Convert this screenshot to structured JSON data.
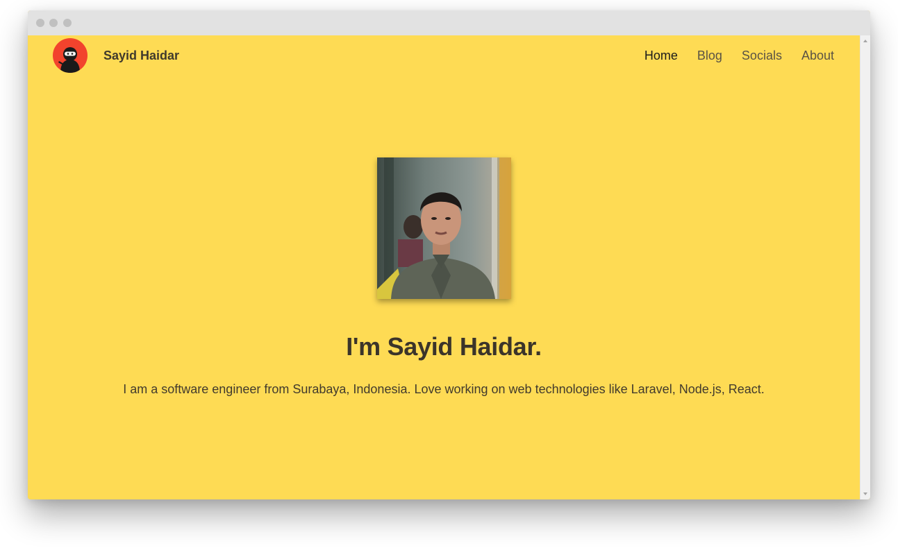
{
  "header": {
    "brand_name": "Sayid Haidar",
    "logo_icon": "ninja-avatar-icon"
  },
  "nav": {
    "items": [
      {
        "label": "Home",
        "active": true
      },
      {
        "label": "Blog",
        "active": false
      },
      {
        "label": "Socials",
        "active": false
      },
      {
        "label": "About",
        "active": false
      }
    ]
  },
  "hero": {
    "headline": "I'm Sayid Haidar.",
    "tagline": "I am a software engineer from Surabaya, Indonesia. Love working on web technologies like Laravel, Node.js, React."
  },
  "colors": {
    "page_background": "#fedb54",
    "logo_background": "#f2432d",
    "titlebar": "#e2e2e2"
  }
}
